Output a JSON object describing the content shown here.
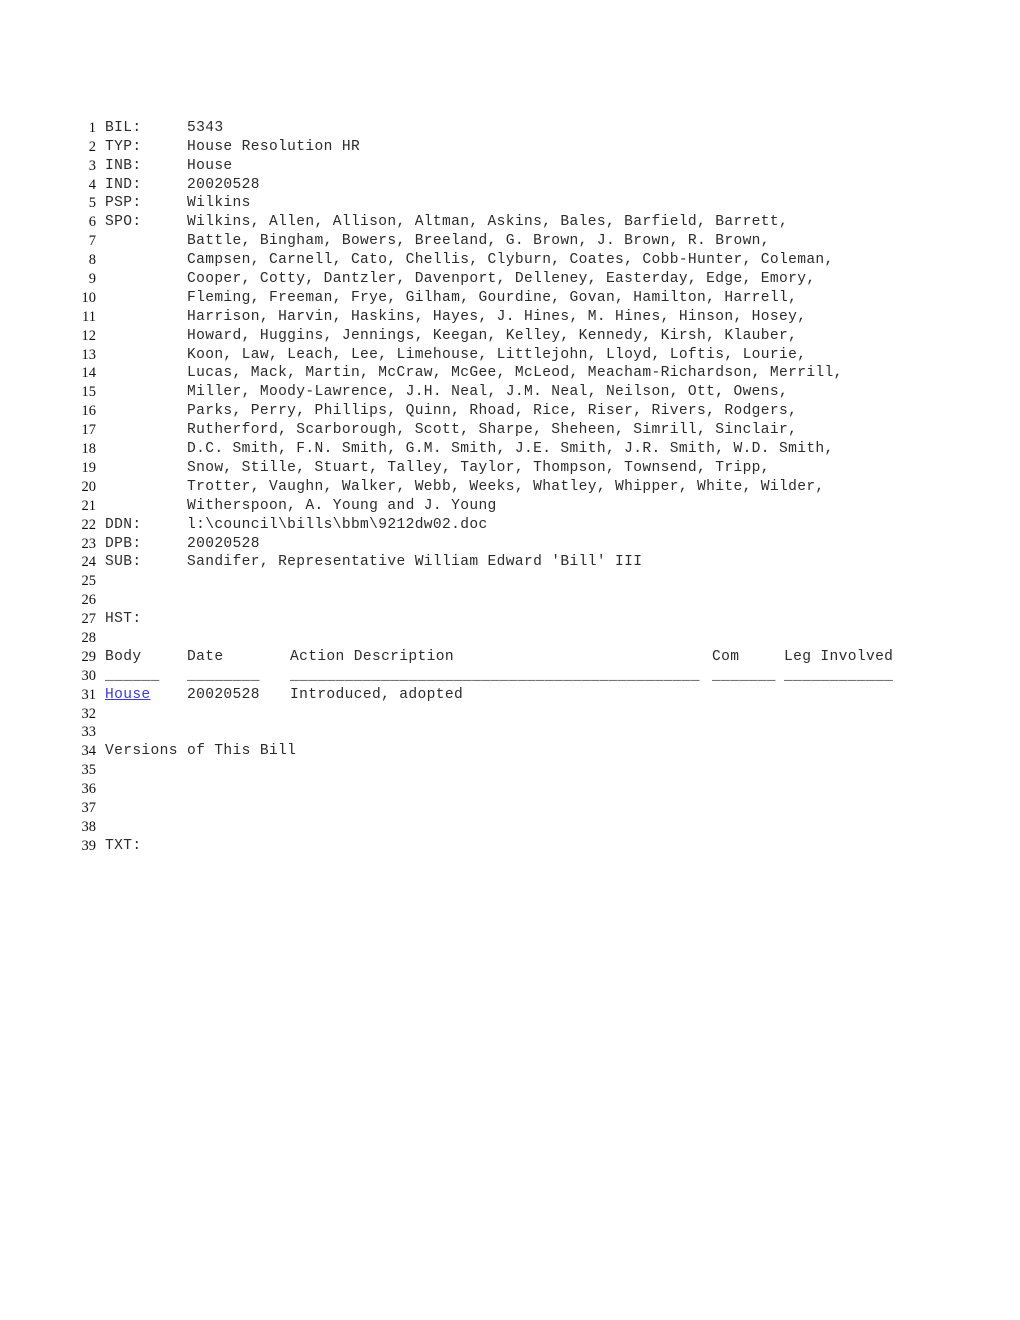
{
  "document": {
    "link_color": "#3a3ad0",
    "text_color": "#2b2b2b",
    "fields": {
      "bil_tag": "BIL:",
      "bil_value": "5343",
      "typ_tag": "TYP:",
      "typ_value": "House Resolution HR",
      "inb_tag": "INB:",
      "inb_value": "House",
      "ind_tag": "IND:",
      "ind_value": "20020528",
      "psp_tag": "PSP:",
      "psp_value": "Wilkins",
      "spo_tag": "SPO:",
      "ddn_tag": "DDN:",
      "ddn_value": "l:\\council\\bills\\bbm\\9212dw02.doc",
      "dpb_tag": "DPB:",
      "dpb_value": "20020528",
      "sub_tag": "SUB:",
      "sub_value": "Sandifer, Representative William Edward 'Bill' III",
      "hst_tag": "HST:",
      "txt_tag": "TXT:"
    },
    "sponsors_lines": [
      "Wilkins, Allen, Allison, Altman, Askins, Bales, Barfield, Barrett,",
      "Battle, Bingham, Bowers, Breeland, G. Brown, J. Brown, R. Brown,",
      "Campsen, Carnell, Cato, Chellis, Clyburn, Coates, Cobb-Hunter, Coleman,",
      "Cooper, Cotty, Dantzler, Davenport, Delleney, Easterday, Edge, Emory,",
      "Fleming, Freeman, Frye, Gilham, Gourdine, Govan, Hamilton, Harrell,",
      "Harrison, Harvin, Haskins, Hayes, J. Hines, M. Hines, Hinson, Hosey,",
      "Howard, Huggins, Jennings, Keegan, Kelley, Kennedy, Kirsh, Klauber,",
      "Koon, Law, Leach, Lee, Limehouse, Littlejohn, Lloyd, Loftis, Lourie,",
      "Lucas, Mack, Martin, McCraw, McGee, McLeod, Meacham-Richardson, Merrill,",
      "Miller, Moody-Lawrence, J.H. Neal, J.M. Neal, Neilson, Ott, Owens,",
      "Parks, Perry, Phillips, Quinn, Rhoad, Rice, Riser, Rivers, Rodgers,",
      "Rutherford, Scarborough, Scott, Sharpe, Sheheen, Simrill, Sinclair,",
      "D.C. Smith, F.N. Smith, G.M. Smith, J.E. Smith, J.R. Smith, W.D. Smith,",
      "Snow, Stille, Stuart, Talley, Taylor, Thompson, Townsend, Tripp,",
      "Trotter, Vaughn, Walker, Webb, Weeks, Whatley, Whipper, White, Wilder,",
      "Witherspoon, A. Young and J. Young"
    ],
    "history_table": {
      "headers": {
        "body": "Body",
        "date": "Date",
        "action": "Action Description",
        "com": "Com",
        "leg": "Leg Involved"
      },
      "rule": {
        "body": "______",
        "date": "________",
        "action": "_____________________________________________",
        "com": "_______",
        "leg": "____________"
      },
      "rows": [
        {
          "body": "House",
          "date": "20020528",
          "action": "Introduced, adopted",
          "com": "",
          "leg": ""
        }
      ]
    },
    "versions_heading": "Versions of This Bill",
    "line_numbers": [
      "1",
      "2",
      "3",
      "4",
      "5",
      "6",
      "7",
      "8",
      "9",
      "10",
      "11",
      "12",
      "13",
      "14",
      "15",
      "16",
      "17",
      "18",
      "19",
      "20",
      "21",
      "22",
      "23",
      "24",
      "25",
      "26",
      "27",
      "28",
      "29",
      "30",
      "31",
      "32",
      "33",
      "34",
      "35",
      "36",
      "37",
      "38",
      "39"
    ]
  }
}
